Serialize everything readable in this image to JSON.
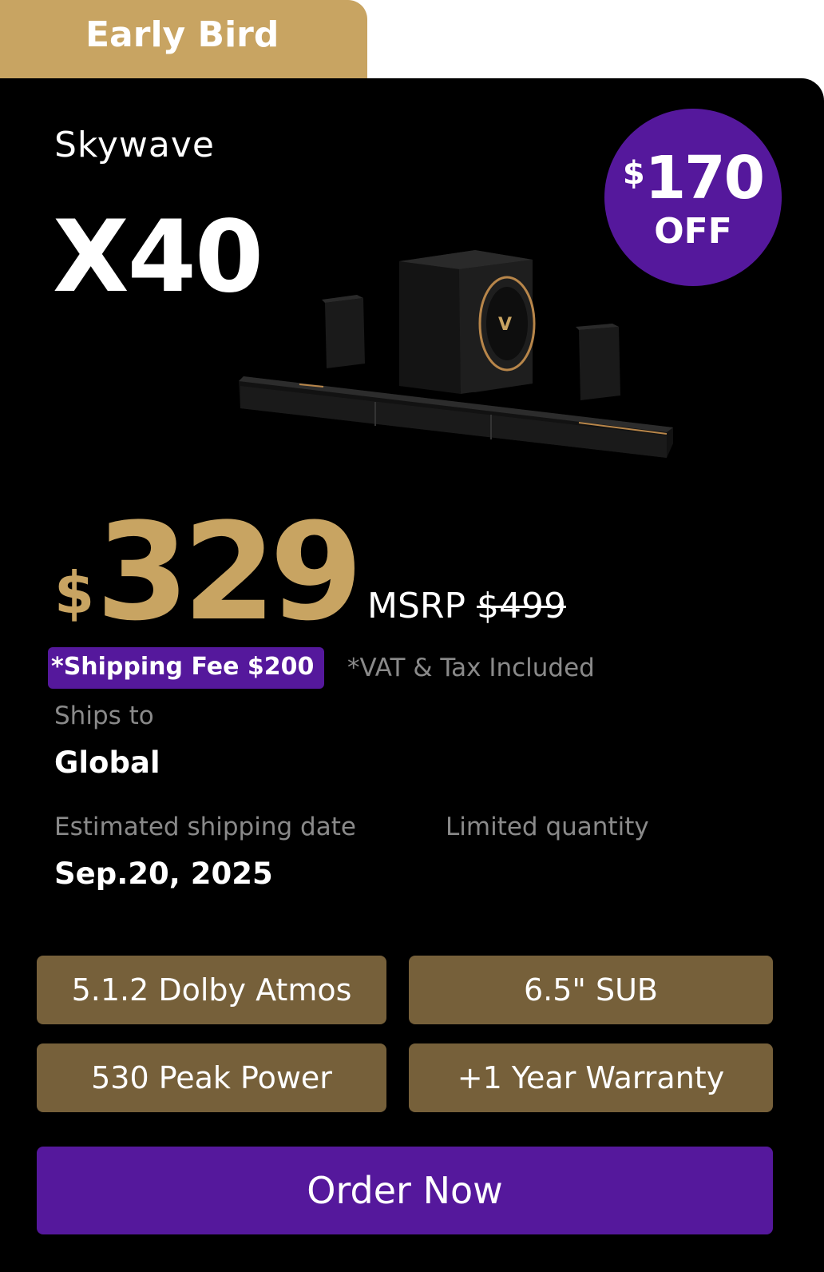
{
  "badge": {
    "label": "Early Bird",
    "color": "#c8a462"
  },
  "product": {
    "brand": "Skywave",
    "model": "X40",
    "image_alt": "Soundbar system with subwoofer and two rear speakers"
  },
  "discount": {
    "currency": "$",
    "amount": "170",
    "label": "OFF",
    "color": "#55189c"
  },
  "pricing": {
    "currency": "$",
    "price": "329",
    "msrp_label": "MSRP",
    "msrp_value": "$499",
    "shipping_fee": "*Shipping Fee $200",
    "tax_note": "*VAT & Tax Included"
  },
  "shipping": {
    "ships_to_label": "Ships to",
    "ships_to_value": "Global",
    "date_label": "Estimated shipping date",
    "date_value": "Sep.20, 2025",
    "quantity_label": "Limited quantity"
  },
  "features": [
    "5.1.2 Dolby Atmos",
    "6.5\" SUB",
    "530 Peak Power",
    "+1 Year Warranty"
  ],
  "cta": {
    "label": "Order Now"
  },
  "colors": {
    "gold": "#c8a462",
    "purple": "#55189c",
    "feature_bg": "#76603a",
    "card_bg": "#000000"
  }
}
